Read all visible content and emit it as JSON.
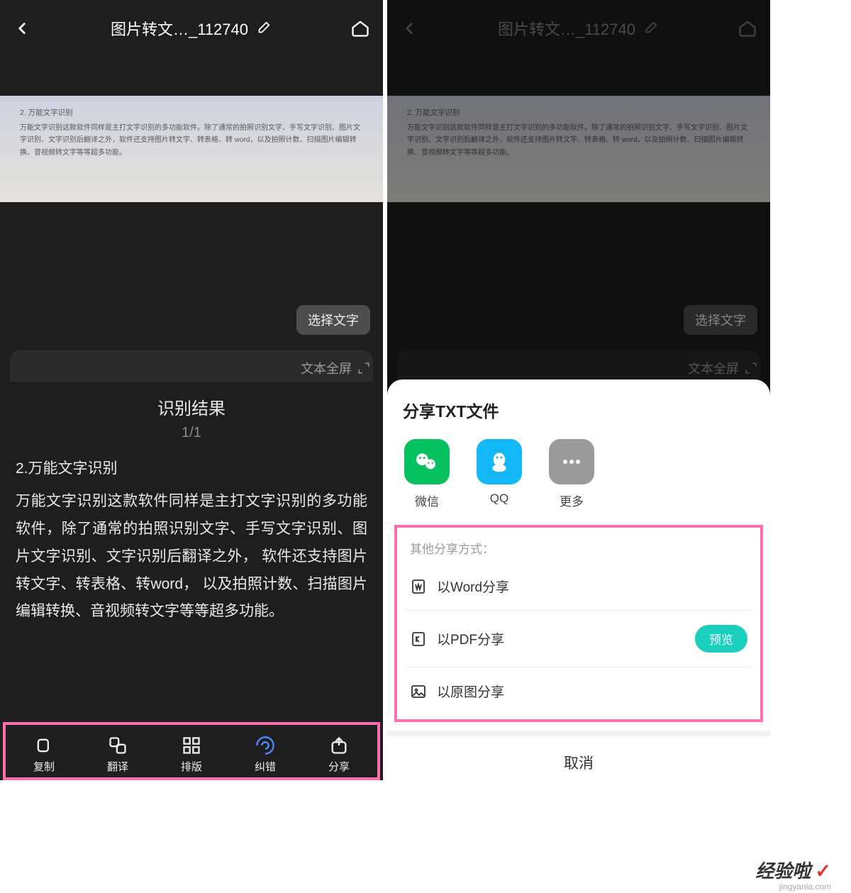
{
  "header": {
    "title": "图片转文…_112740"
  },
  "scan": {
    "title": "2. 万能文字识别",
    "body": "万能文字识别这款软件同样是主打文字识别的多功能软件。除了通常的拍照识别文字、手写文字识别、图片文字识别、文字识别后翻译之外，软件还支持图片转文字、转表格、转 word，以及拍照计数、扫描图片编辑转换、音视频转文字等等超多功能。"
  },
  "pill": {
    "select_text": "选择文字"
  },
  "fs_bar": {
    "label": "文本全屏"
  },
  "result": {
    "heading": "识别结果",
    "pager": "1/1",
    "line1": "2.万能文字识别",
    "para": "万能文字识别这款软件同样是主打文字识别的多功能软件，除了通常的拍照识别文字、手写文字识别、图片文字识别、文字识别后翻译之外， 软件还支持图片转文字、转表格、转word， 以及拍照计数、扫描图片编辑转换、音视频转文字等等超多功能。"
  },
  "toolbar": {
    "copy": "复制",
    "translate": "翻译",
    "layout": "排版",
    "correct": "纠错",
    "share": "分享"
  },
  "sheet": {
    "title": "分享TXT文件",
    "share_items": {
      "wechat": "微信",
      "qq": "QQ",
      "more": "更多"
    },
    "other_title": "其他分享方式：",
    "other": {
      "word": "以Word分享",
      "pdf": "以PDF分享",
      "image": "以原图分享",
      "preview": "预览"
    },
    "cancel": "取消"
  },
  "watermark": {
    "cn": "经验啦",
    "url": "jingyanla.com"
  }
}
